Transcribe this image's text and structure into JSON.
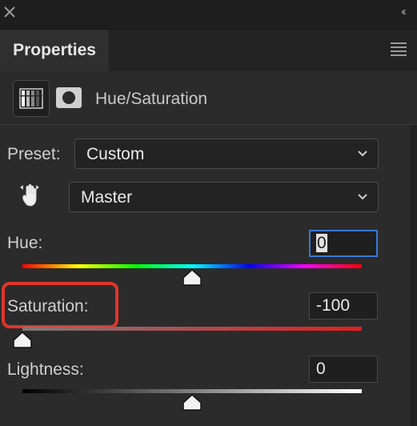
{
  "panel": {
    "title": "Properties",
    "adjustment_title": "Hue/Saturation"
  },
  "preset": {
    "label": "Preset:",
    "value": "Custom"
  },
  "channel": {
    "value": "Master"
  },
  "sliders": {
    "hue": {
      "label": "Hue:",
      "value": "0",
      "level": 0.5
    },
    "saturation": {
      "label": "Saturation:",
      "value": "-100",
      "level": 0.0
    },
    "lightness": {
      "label": "Lightness:",
      "value": "0",
      "level": 0.5
    }
  },
  "colors": {
    "highlight": "#e0352b",
    "focus": "#3a78d6"
  }
}
